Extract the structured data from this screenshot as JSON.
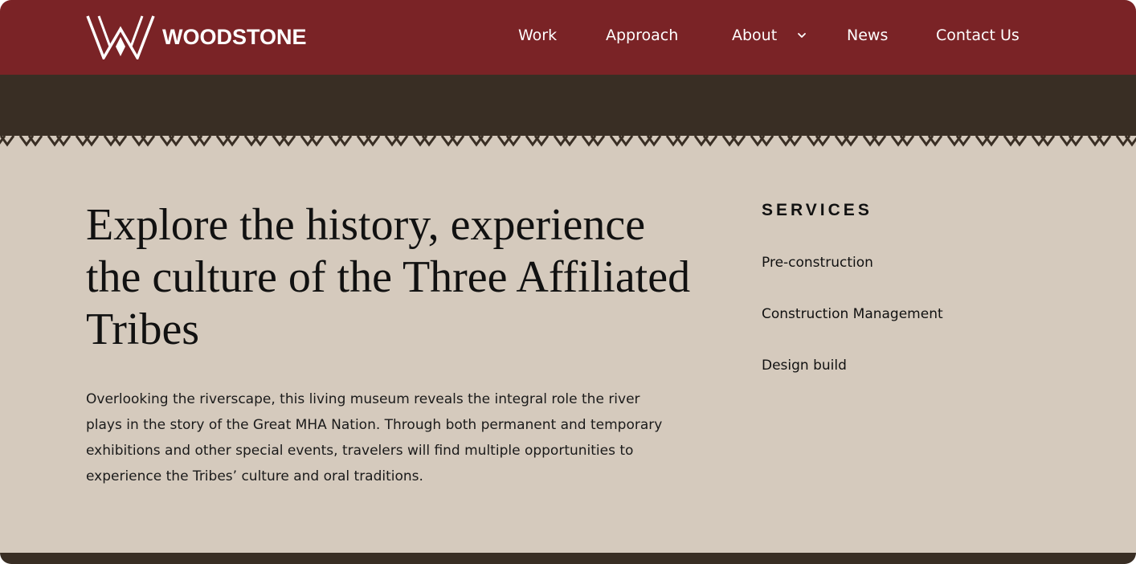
{
  "brand": {
    "name": "WOODSTONE",
    "logo_icon": "woodstone-w-logo"
  },
  "nav": {
    "items": [
      {
        "label": "Work"
      },
      {
        "label": "Approach"
      },
      {
        "label": "About",
        "has_dropdown": true
      },
      {
        "label": "News"
      },
      {
        "label": "Contact Us"
      }
    ]
  },
  "hero": {
    "headline": "Explore the history, experience the culture of the Three Affiliated Tribes",
    "body": "Overlooking the riverscape, this living museum reveals the integral role the river plays in the story of the Great MHA Nation. Through both permanent and temporary exhibitions and other special events, travelers will find multiple opportunities to experience the Tribes’ culture and oral traditions."
  },
  "services": {
    "heading": "SERVICES",
    "items": [
      {
        "label": "Pre-construction"
      },
      {
        "label": "Construction Management"
      },
      {
        "label": "Design build"
      }
    ]
  },
  "colors": {
    "header_bg": "#7a2326",
    "band_bg": "#392e24",
    "page_bg": "#d5cabd",
    "text": "#111111",
    "on_header": "#ffffff"
  }
}
